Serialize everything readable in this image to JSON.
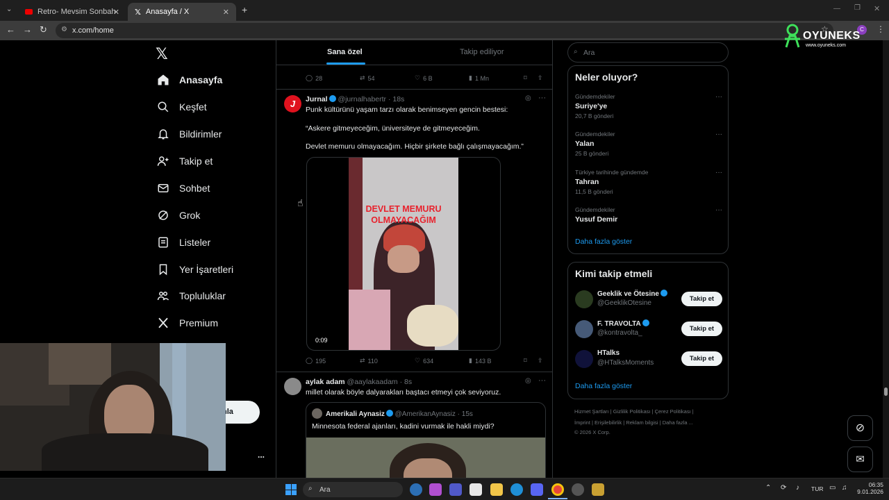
{
  "browser": {
    "tabs": [
      {
        "title": "Retro- Mevsim Sonbahar X MV",
        "active": false
      },
      {
        "title": "Anasayfa / X",
        "active": true
      }
    ],
    "url": "x.com/home",
    "overlay_logo": "OYUNEKS",
    "overlay_logo_url": "www.oyuneks.com"
  },
  "nav": {
    "items": [
      {
        "label": "Anasayfa",
        "icon": "home-icon"
      },
      {
        "label": "Keşfet",
        "icon": "search-icon"
      },
      {
        "label": "Bildirimler",
        "icon": "bell-icon"
      },
      {
        "label": "Takip et",
        "icon": "person-add-icon"
      },
      {
        "label": "Sohbet",
        "icon": "mail-icon"
      },
      {
        "label": "Grok",
        "icon": "grok-icon"
      },
      {
        "label": "Listeler",
        "icon": "list-icon"
      },
      {
        "label": "Yer İşaretleri",
        "icon": "bookmark-icon"
      },
      {
        "label": "Topluluklar",
        "icon": "people-icon"
      },
      {
        "label": "Premium",
        "icon": "x-icon"
      }
    ],
    "post_button_fragment": "nla",
    "more_dots": "..."
  },
  "feed": {
    "tabs": [
      "Sana özel",
      "Takip ediliyor"
    ],
    "top_actions": {
      "replies": "28",
      "reposts": "54",
      "likes": "6 B",
      "views": "1 Mn"
    },
    "tweet1": {
      "author": "Jurnal",
      "handle": "@jurnalhabertr",
      "time": "· 18s",
      "avatar_letter": "J",
      "line1": "Punk kültürünü yaşam tarzı olarak benimseyen gencin bestesi:",
      "line2": "“Askere gitmeyeceğim, üniversiteye de gitmeyeceğim.",
      "line3": "Devlet memuru olmayacağım. Hiçbir şirkete bağlı çalışmayacağım.”",
      "video_caption_1": "DEVLET MEMURU",
      "video_caption_2": "OLMAYACAĞIM",
      "video_time": "0:09",
      "actions": {
        "replies": "195",
        "reposts": "110",
        "likes": "634",
        "views": "143 B"
      }
    },
    "tweet2": {
      "author": "aylak adam",
      "handle": "@aaylakaadam",
      "time": "· 8s",
      "text": "millet olarak böyle dalyarakları baştacı etmeyi çok seviyoruz.",
      "quote_author": "Amerikali Aynasiz",
      "quote_handle": "@AmerikanAynasiz",
      "quote_time": "· 15s",
      "quote_text": "Minnesota federal ajanları, kadini vurmak ile hakli miydi?"
    }
  },
  "sidebar": {
    "search_placeholder": "Ara",
    "trends_title": "Neler oluyor?",
    "trends": [
      {
        "category": "Gündemdekiler",
        "name": "Suriye'ye",
        "count": "20,7 B gönderi"
      },
      {
        "category": "Gündemdekiler",
        "name": "Yalan",
        "count": "25 B gönderi"
      },
      {
        "category": "Türkiye tarihinde gündemde",
        "name": "Tahran",
        "count": "11,5 B gönderi"
      },
      {
        "category": "Gündemdekiler",
        "name": "Yusuf Demir",
        "count": ""
      }
    ],
    "show_more": "Daha fazla göster",
    "who_to_follow_title": "Kimi takip etmeli",
    "follow": [
      {
        "name": "Geeklik ve Ötesine",
        "handle": "@GeeklikOtesine",
        "button": "Takip et",
        "verified": true
      },
      {
        "name": "F. TRAVOLTA",
        "handle": "@kontravolta_",
        "button": "Takip et",
        "verified": true
      },
      {
        "name": "HTalks",
        "handle": "@HTalksMoments",
        "button": "Takip et",
        "verified": false
      }
    ],
    "show_more_2": "Daha fazla göster",
    "footer_line1": "Hizmet Şartları  |  Gizlilik Politikası  |  Çerez Politikası  |",
    "footer_line2": "İmprint  |  Erişilebilirlik  |  Reklam bilgisi  |  Daha fazla ...",
    "footer_line3": "© 2026 X Corp."
  },
  "taskbar": {
    "search_label": "Ara",
    "lang": "TUR",
    "time": "06:35",
    "date": "9.01.2026"
  },
  "colors": {
    "accent": "#1d9bf0",
    "background": "#000000",
    "border": "#2f3336"
  }
}
